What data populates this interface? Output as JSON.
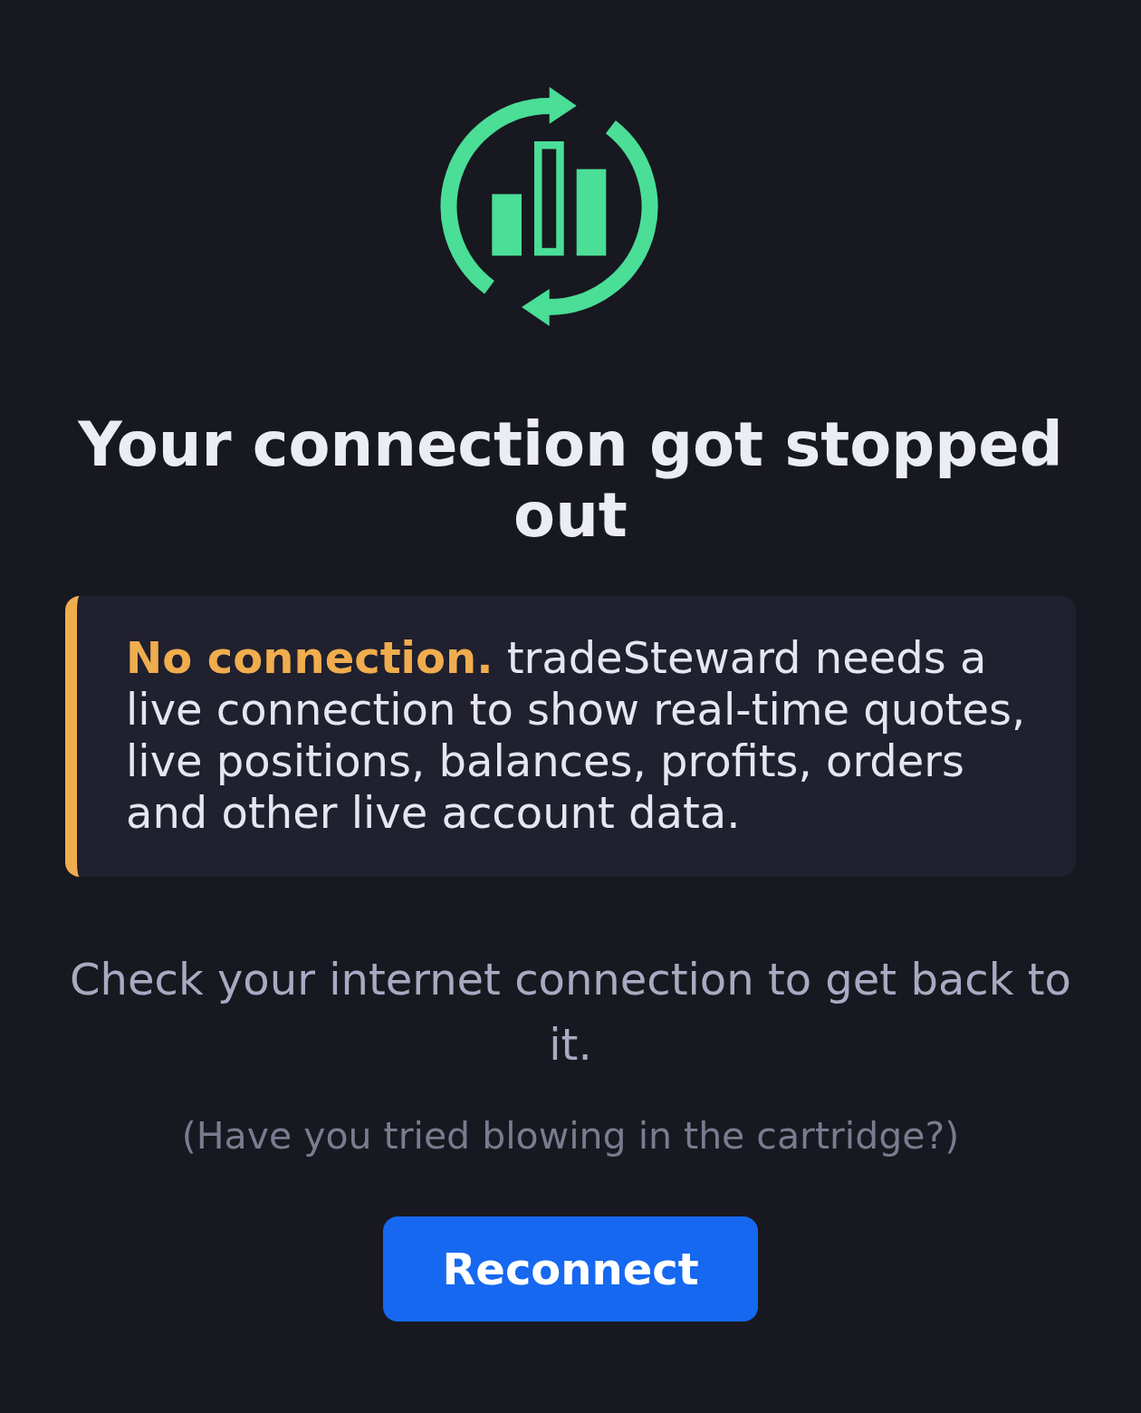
{
  "title": "Your connection got stopped out",
  "alert": {
    "text": "**No connection.** tradeSteward needs a live connection to show real-time quotes, live positions, balances, profits, orders and other live account data."
  },
  "message": "Check your internet connection to get back to it.",
  "hint": "(Have you tried blowing in the cartridge?)",
  "button": {
    "label": "Reconnect"
  }
}
